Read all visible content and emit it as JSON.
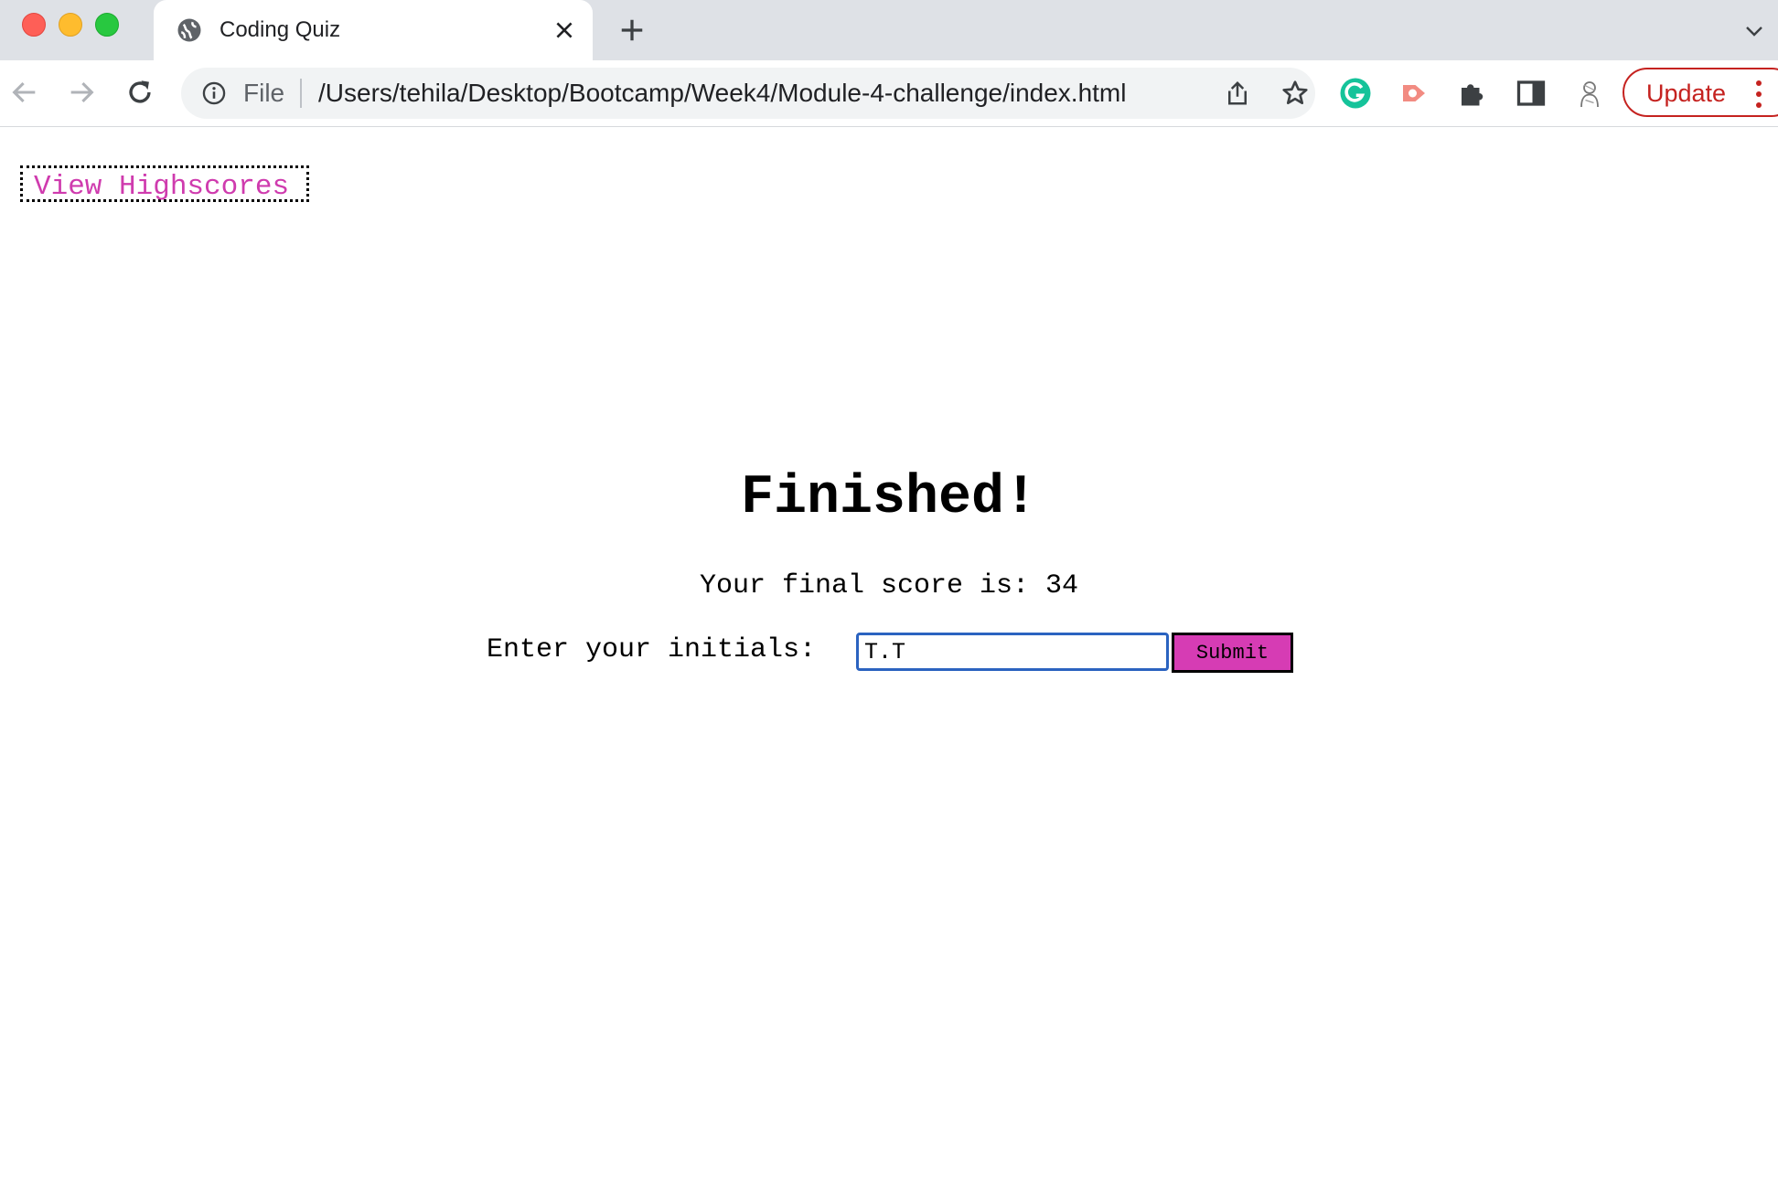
{
  "browser": {
    "tab_title": "Coding Quiz",
    "address_scheme": "File",
    "address_url": "/Users/tehila/Desktop/Bootcamp/Week4/Module-4-challenge/index.html",
    "update_label": "Update",
    "accent_color": "#c5221f"
  },
  "page": {
    "highscores_link": "View Highscores",
    "heading": "Finished!",
    "score_text": "Your final score is: 34",
    "initials_label": "Enter your initials:",
    "initials_value": "T.T",
    "submit_label": "Submit",
    "link_color": "#cf3bae",
    "button_color": "#d63cb4"
  }
}
